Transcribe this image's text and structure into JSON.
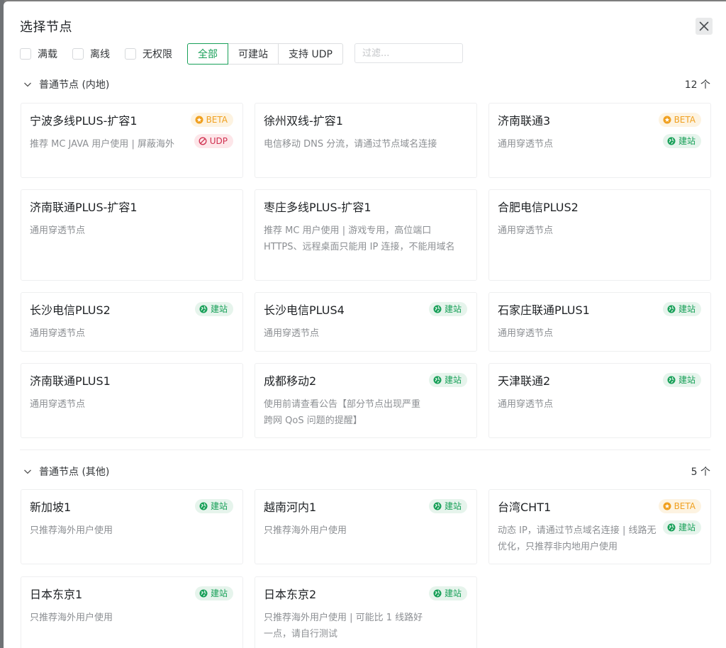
{
  "modal": {
    "title": "选择节点",
    "close_icon": "close-icon"
  },
  "filters": {
    "checkboxes": [
      {
        "label": "满载",
        "checked": false
      },
      {
        "label": "离线",
        "checked": false
      },
      {
        "label": "无权限",
        "checked": false
      }
    ],
    "buttons": [
      {
        "label": "全部",
        "active": true
      },
      {
        "label": "可建站",
        "active": false
      },
      {
        "label": "支持 UDP",
        "active": false
      }
    ],
    "search": {
      "placeholder": "过滤...",
      "value": ""
    }
  },
  "colors": {
    "accent": "#18a058",
    "beta": "#f0a020",
    "udp": "#d03050",
    "text": "#333639",
    "muted": "#8c8f93"
  },
  "tags": {
    "beta": {
      "label": "BETA",
      "icon": "star-badge-icon"
    },
    "udp": {
      "label": "UDP",
      "icon": "ban-icon"
    },
    "site": {
      "label": "建站",
      "icon": "globe-icon"
    }
  },
  "sections": [
    {
      "title": "普通节点 (内地)",
      "count": "12 个",
      "expanded": true,
      "nodes": [
        {
          "name": "宁波多线PLUS-扩容1",
          "desc": "推荐 MC JAVA 用户使用 | 屏蔽海外",
          "tags": [
            "beta",
            "udp"
          ]
        },
        {
          "name": "徐州双线-扩容1",
          "desc": "电信移动 DNS 分流，请通过节点域名连接",
          "tags": []
        },
        {
          "name": "济南联通3",
          "desc": "通用穿透节点",
          "tags": [
            "beta",
            "site"
          ]
        },
        {
          "name": "济南联通PLUS-扩容1",
          "desc": "通用穿透节点",
          "tags": []
        },
        {
          "name": "枣庄多线PLUS-扩容1",
          "desc": "推荐 MC 用户使用 | 游戏专用，高位端口 HTTPS、远程桌面只能用 IP 连接，不能用域名",
          "tags": []
        },
        {
          "name": "合肥电信PLUS2",
          "desc": "通用穿透节点",
          "tags": []
        },
        {
          "name": "长沙电信PLUS2",
          "desc": "通用穿透节点",
          "tags": [
            "site"
          ]
        },
        {
          "name": "长沙电信PLUS4",
          "desc": "通用穿透节点",
          "tags": [
            "site"
          ]
        },
        {
          "name": "石家庄联通PLUS1",
          "desc": "通用穿透节点",
          "tags": [
            "site"
          ]
        },
        {
          "name": "济南联通PLUS1",
          "desc": "通用穿透节点",
          "tags": []
        },
        {
          "name": "成都移动2",
          "desc": "使用前请查看公告【部分节点出现严重跨网 QoS 问题的提醒】",
          "tags": [
            "site"
          ]
        },
        {
          "name": "天津联通2",
          "desc": "通用穿透节点",
          "tags": [
            "site"
          ]
        }
      ]
    },
    {
      "title": "普通节点 (其他)",
      "count": "5 个",
      "expanded": true,
      "nodes": [
        {
          "name": "新加坡1",
          "desc": "只推荐海外用户使用",
          "tags": [
            "site"
          ]
        },
        {
          "name": "越南河内1",
          "desc": "只推荐海外用户使用",
          "tags": [
            "site"
          ]
        },
        {
          "name": "台湾CHT1",
          "desc": "动态 IP，请通过节点域名连接 | 线路无优化，只推荐非内地用户使用",
          "tags": [
            "beta",
            "site"
          ]
        },
        {
          "name": "日本东京1",
          "desc": "只推荐海外用户使用",
          "tags": [
            "site"
          ]
        },
        {
          "name": "日本东京2",
          "desc": "只推荐海外用户使用 | 可能比 1 线路好一点，请自行测试",
          "tags": [
            "site"
          ]
        }
      ]
    }
  ]
}
